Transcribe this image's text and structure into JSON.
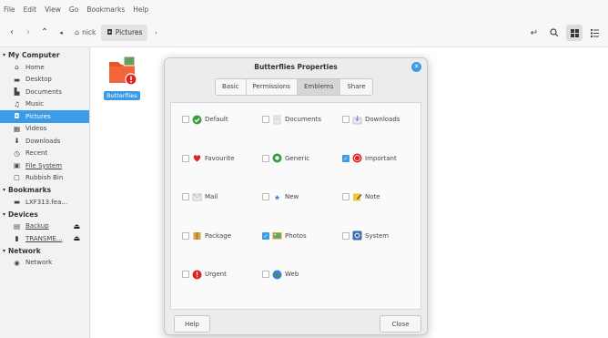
{
  "menubar": [
    "File",
    "Edit",
    "View",
    "Go",
    "Bookmarks",
    "Help"
  ],
  "toolbar": {
    "breadcrumbs": [
      {
        "icon": "home-icon",
        "label": "nick"
      },
      {
        "icon": "camera-icon",
        "label": "Pictures"
      }
    ],
    "right_icons": [
      "restore-icon",
      "search-icon",
      "grid-view-icon",
      "list-view-icon"
    ]
  },
  "sidebar": {
    "sections": [
      {
        "title": "My Computer",
        "items": [
          {
            "label": "Home",
            "icon": "home-icon"
          },
          {
            "label": "Desktop",
            "icon": "desktop-icon"
          },
          {
            "label": "Documents",
            "icon": "documents-icon"
          },
          {
            "label": "Music",
            "icon": "music-icon"
          },
          {
            "label": "Pictures",
            "icon": "pictures-icon",
            "selected": true
          },
          {
            "label": "Videos",
            "icon": "videos-icon"
          },
          {
            "label": "Downloads",
            "icon": "downloads-icon"
          },
          {
            "label": "Recent",
            "icon": "recent-icon"
          },
          {
            "label": "File System",
            "icon": "filesystem-icon"
          },
          {
            "label": "Rubbish Bin",
            "icon": "trash-icon"
          }
        ]
      },
      {
        "title": "Bookmarks",
        "items": [
          {
            "label": "LXF313.fea...",
            "icon": "folder-icon"
          }
        ]
      },
      {
        "title": "Devices",
        "items": [
          {
            "label": "Backup",
            "icon": "drive-icon",
            "eject": true
          },
          {
            "label": "TRANSME...",
            "icon": "usb-icon",
            "eject": true
          }
        ]
      },
      {
        "title": "Network",
        "items": [
          {
            "label": "Network",
            "icon": "network-icon"
          }
        ]
      }
    ]
  },
  "file": {
    "label": "Butterflies"
  },
  "dialog": {
    "title": "Butterflies Properties",
    "tabs": [
      "Basic",
      "Permissions",
      "Emblems",
      "Share"
    ],
    "active_tab": "Emblems",
    "emblems": [
      {
        "label": "Default",
        "checked": false,
        "icon": "default-emblem-icon"
      },
      {
        "label": "Documents",
        "checked": false,
        "icon": "documents-emblem-icon"
      },
      {
        "label": "Downloads",
        "checked": false,
        "icon": "downloads-emblem-icon"
      },
      {
        "label": "Favourite",
        "checked": false,
        "icon": "heart-icon"
      },
      {
        "label": "Generic",
        "checked": false,
        "icon": "generic-emblem-icon"
      },
      {
        "label": "Important",
        "checked": true,
        "icon": "important-emblem-icon"
      },
      {
        "label": "Mail",
        "checked": false,
        "icon": "mail-icon"
      },
      {
        "label": "New",
        "checked": false,
        "icon": "new-emblem-icon"
      },
      {
        "label": "Note",
        "checked": false,
        "icon": "note-icon"
      },
      {
        "label": "Package",
        "checked": false,
        "icon": "package-icon"
      },
      {
        "label": "Photos",
        "checked": true,
        "icon": "photos-icon"
      },
      {
        "label": "System",
        "checked": false,
        "icon": "system-icon"
      },
      {
        "label": "Urgent",
        "checked": false,
        "icon": "urgent-icon"
      },
      {
        "label": "Web",
        "checked": false,
        "icon": "web-icon"
      }
    ],
    "help_label": "Help",
    "close_label": "Close"
  },
  "colors": {
    "accent": "#3c9be6",
    "folder": "#e8542b"
  }
}
